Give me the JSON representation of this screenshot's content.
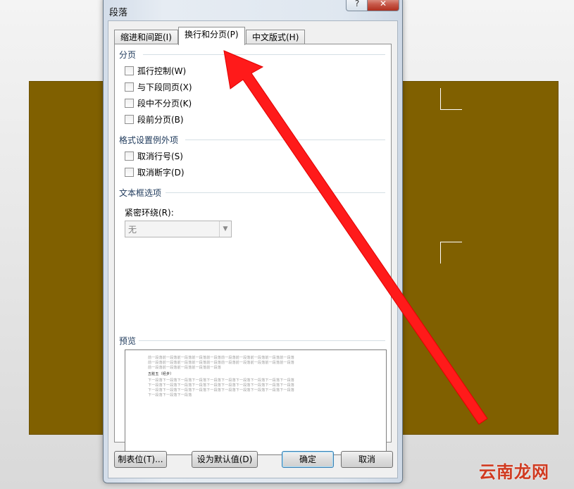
{
  "dialog": {
    "title": "段落",
    "help_label": "?",
    "close_label": "✕"
  },
  "tabs": [
    {
      "label": "缩进和间距(I)",
      "active": false
    },
    {
      "label": "换行和分页(P)",
      "active": true
    },
    {
      "label": "中文版式(H)",
      "active": false
    }
  ],
  "pagination": {
    "title": "分页",
    "options": [
      {
        "label": "孤行控制(W)",
        "checked": false
      },
      {
        "label": "与下段同页(X)",
        "checked": false
      },
      {
        "label": "段中不分页(K)",
        "checked": false
      },
      {
        "label": "段前分页(B)",
        "checked": false
      }
    ]
  },
  "format_exceptions": {
    "title": "格式设置例外项",
    "options": [
      {
        "label": "取消行号(S)",
        "checked": false
      },
      {
        "label": "取消断字(D)",
        "checked": false
      }
    ]
  },
  "textbox_options": {
    "title": "文本框选项",
    "wrap_label": "紧密环绕(R):",
    "wrap_value": "无"
  },
  "preview": {
    "title": "预览",
    "prev_lines": [
      "前一段落前一段落前一段落前一段落前一段落前一段落前一段落前一段落前一段落前一段落",
      "前一段落前一段落前一段落前一段落前一段落前一段落前一段落前一段落前一段落前一段落",
      "前一段落前一段落前一段落前一段落前一段落"
    ],
    "current_line": "五脏五（经步）",
    "next_lines": [
      "下一段落下一段落下一段落下一段落下一段落下一段落下一段落下一段落下一段落下一段落",
      "下一段落下一段落下一段落下一段落下一段落下一段落下一段落下一段落下一段落下一段落",
      "下一段落下一段落下一段落下一段落下一段落下一段落下一段落下一段落下一段落下一段落",
      "下一段落下一段落下一段落"
    ]
  },
  "buttons": {
    "tabs": "制表位(T)...",
    "set_default": "设为默认值(D)",
    "ok": "确定",
    "cancel": "取消"
  },
  "watermark": "云南龙网",
  "colors": {
    "document_background": "#806000",
    "arrow": "#ff1a1a",
    "section_title": "#1e395b"
  }
}
